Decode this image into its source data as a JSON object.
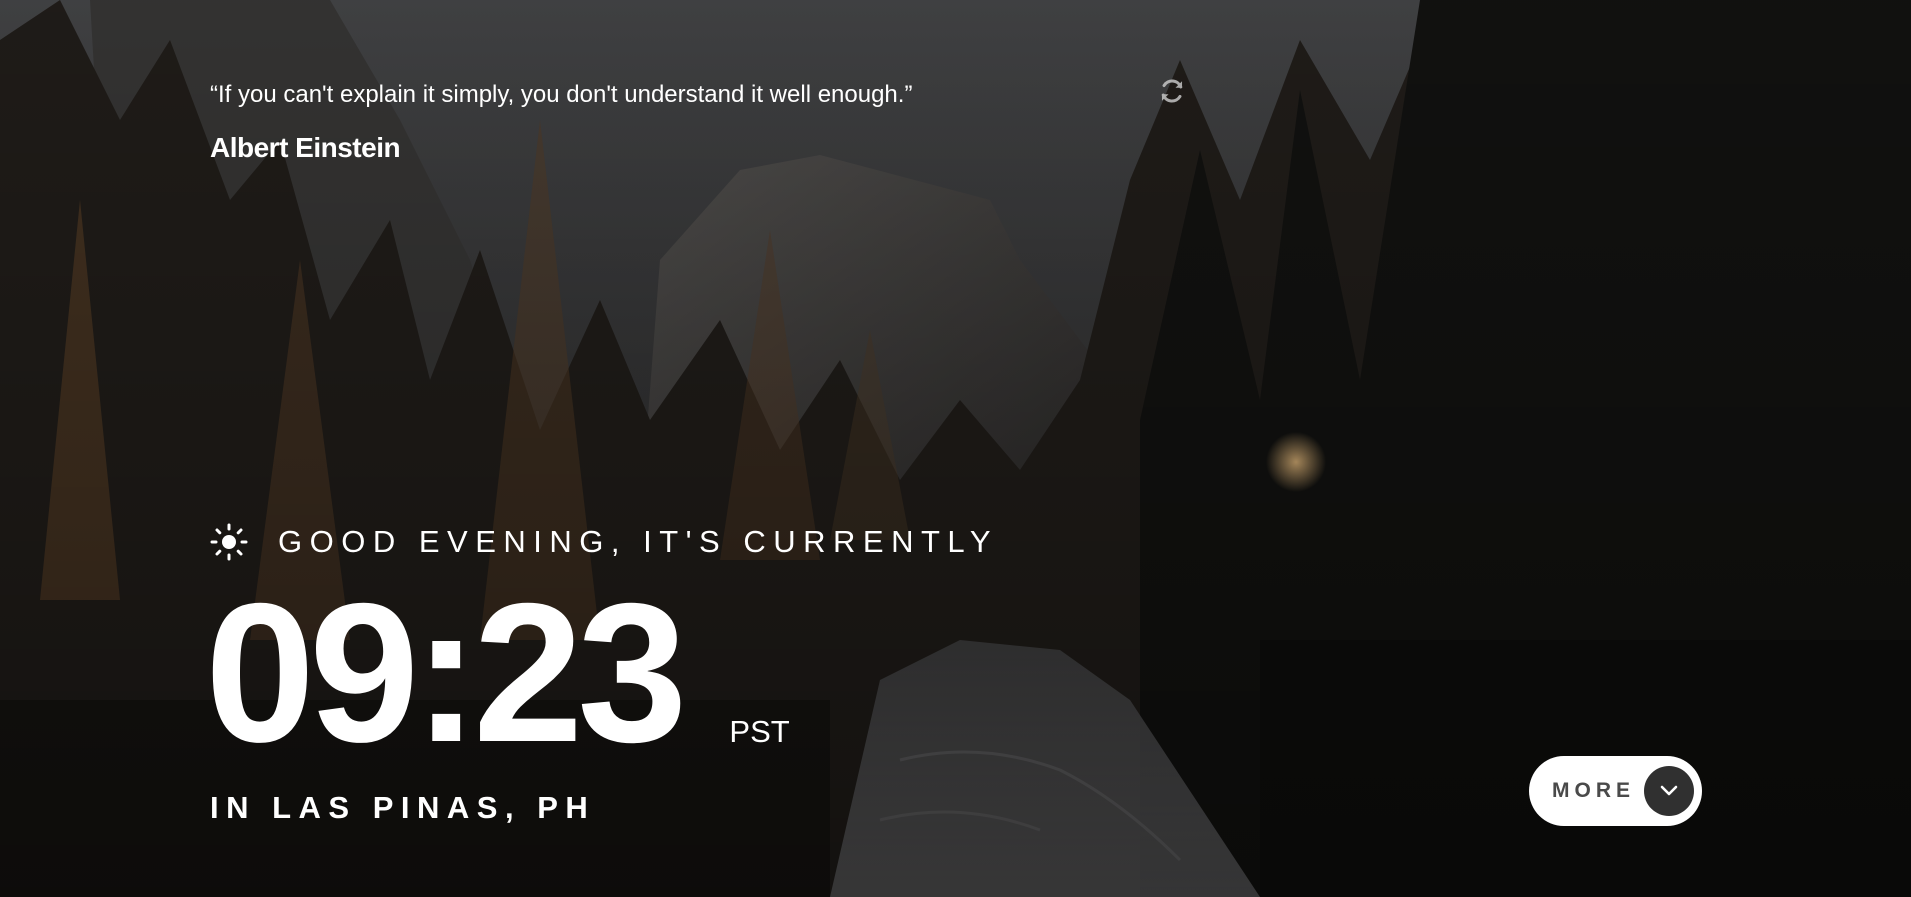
{
  "quote": {
    "text": "“If you can't explain it simply, you don't understand it well enough.”",
    "author": "Albert Einstein",
    "refresh_icon": "refresh-icon"
  },
  "clock": {
    "greeting_icon": "sun-icon",
    "greeting": "GOOD EVENING, IT'S CURRENTLY",
    "time": "09:23",
    "timezone": "PST",
    "location": "IN LAS PINAS, PH"
  },
  "more_button": {
    "label": "MORE",
    "icon": "chevron-down-icon"
  },
  "colors": {
    "button_bg": "#ffffff",
    "button_text": "#4a4a4a",
    "button_circle": "#303030",
    "text": "#ffffff"
  }
}
